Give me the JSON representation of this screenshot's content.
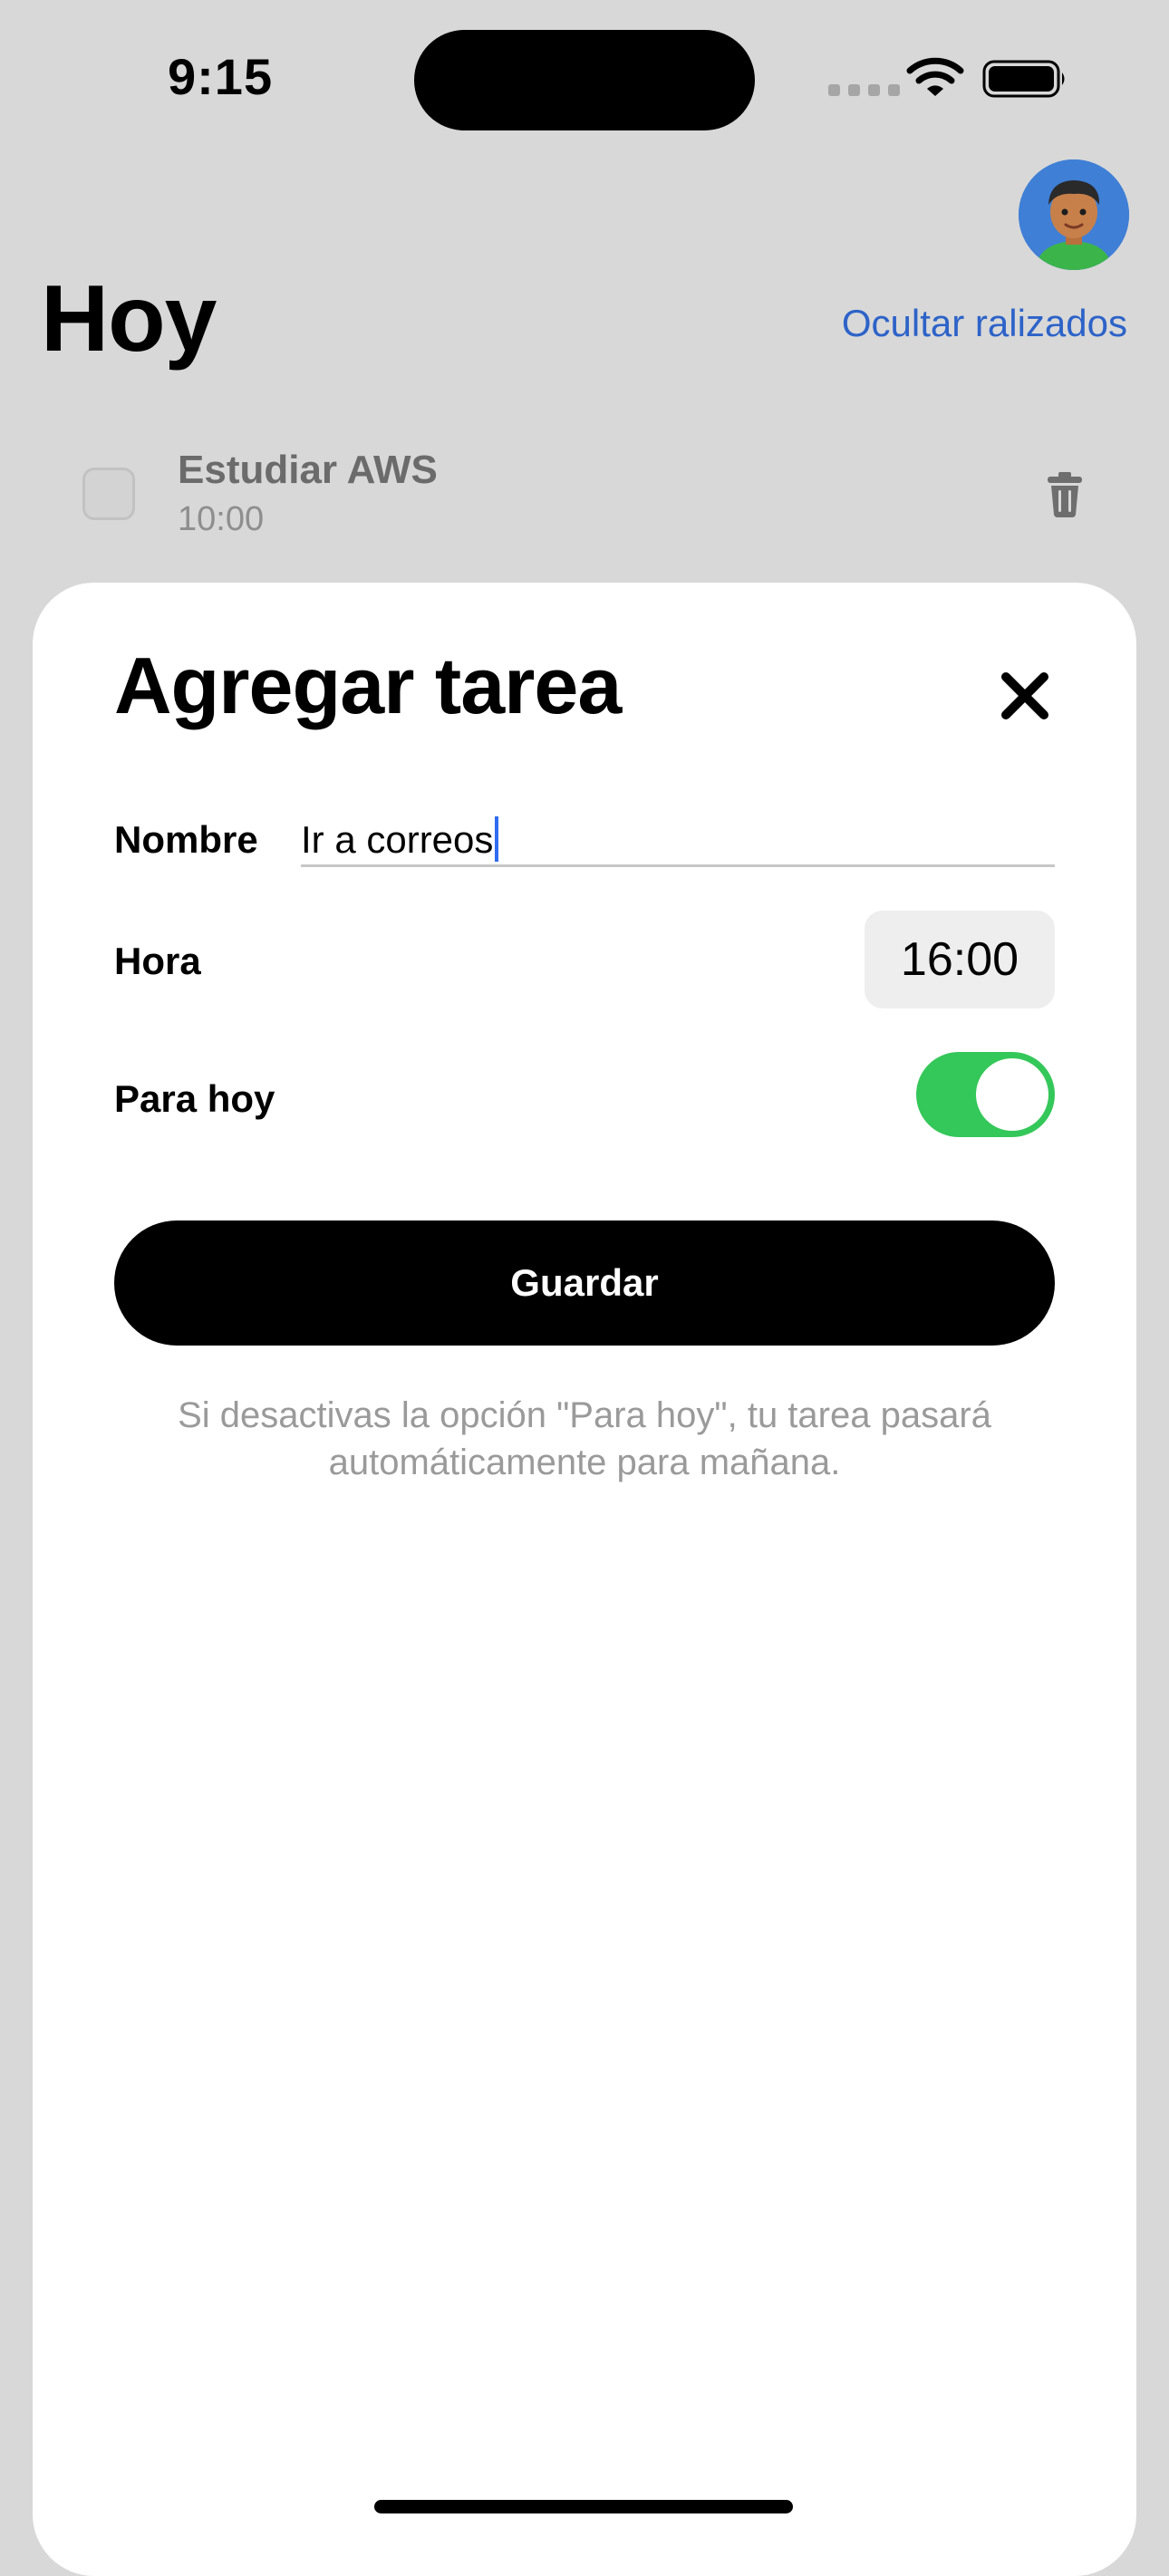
{
  "status_bar": {
    "time": "9:15"
  },
  "background_screen": {
    "title": "Hoy",
    "hide_done_link": "Ocultar ralizados",
    "tasks": [
      {
        "name": "Estudiar AWS",
        "time": "10:00",
        "done": false
      }
    ]
  },
  "sheet": {
    "title": "Agregar tarea",
    "name_label": "Nombre",
    "name_value": "Ir a correos",
    "time_label": "Hora",
    "time_value": "16:00",
    "today_label": "Para hoy",
    "today_enabled": true,
    "save_label": "Guardar",
    "hint": "Si desactivas la opción \"Para hoy\", tu tarea pasará automáticamente para mañana."
  },
  "colors": {
    "accent_link": "#2d63c8",
    "toggle_on": "#34c759",
    "cursor": "#2f6bf0"
  },
  "icons": [
    "wifi-icon",
    "battery-icon",
    "avatar-memoji",
    "trash-icon",
    "close-icon"
  ]
}
